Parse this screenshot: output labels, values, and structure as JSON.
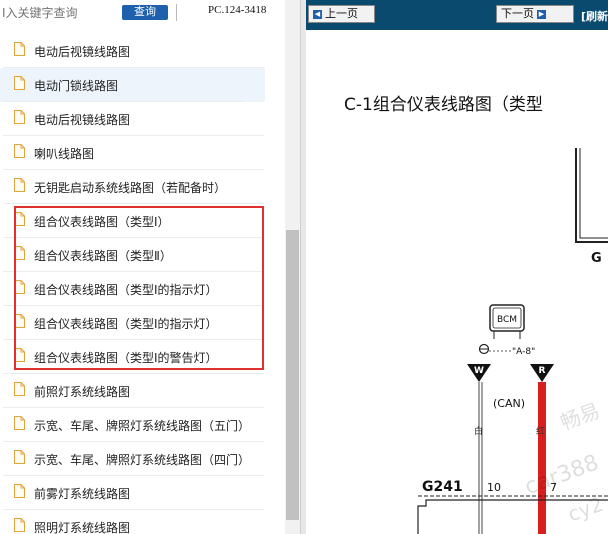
{
  "search": {
    "placeholder": "I入关键字查询",
    "button_label": "查询"
  },
  "page_code": "PC.124-3418",
  "items": [
    {
      "label": "电动后视镜线路图"
    },
    {
      "label": "电动门锁线路图"
    },
    {
      "label": "电动后视镜线路图"
    },
    {
      "label": "喇叭线路图"
    },
    {
      "label": "无钥匙启动系统线路图（若配备时）"
    },
    {
      "label": "组合仪表线路图（类型Ⅰ）"
    },
    {
      "label": "组合仪表线路图（类型Ⅱ）"
    },
    {
      "label": "组合仪表线路图（类型Ⅰ的指示灯）"
    },
    {
      "label": "组合仪表线路图（类型Ⅰ的指示灯）"
    },
    {
      "label": "组合仪表线路图（类型Ⅰ的警告灯）"
    },
    {
      "label": "前照灯系统线路图"
    },
    {
      "label": "示宽、车尾、牌照灯系统线路图（五门）"
    },
    {
      "label": "示宽、车尾、牌照灯系统线路图（四门）"
    },
    {
      "label": "前雾灯系统线路图"
    },
    {
      "label": "照明灯系统线路图"
    }
  ],
  "viewer": {
    "prev_label": "上一页",
    "next_label": "下一页",
    "refresh_label": "[刷新",
    "title": "C-1组合仪表线路图（类型",
    "bcm_label": "BCM",
    "connector_a8": "\"A-8\"",
    "pin_w": "W",
    "pin_r": "R",
    "can_label": "(CAN)",
    "wire_white": "白",
    "wire_red": "红",
    "g_label": "G",
    "connector_g241": "G241",
    "pin_10": "10",
    "pin_7": "7",
    "watermark_1": "畅易",
    "watermark_2": "car388",
    "watermark_3": "cy2"
  }
}
